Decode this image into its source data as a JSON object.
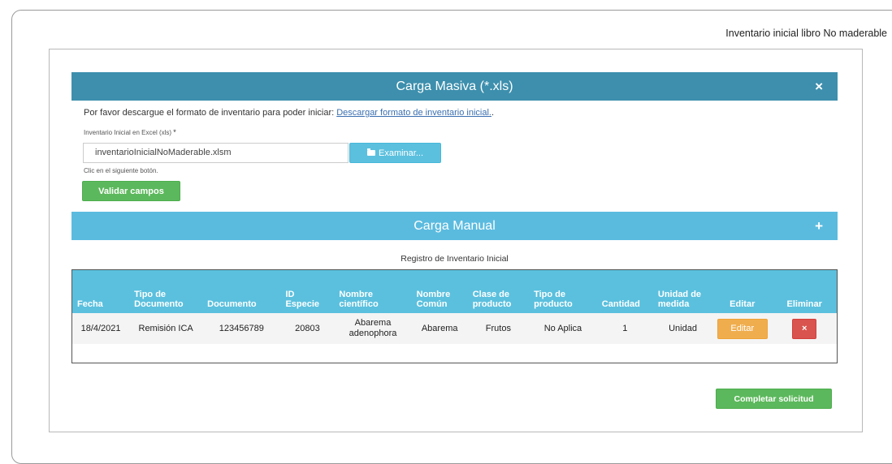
{
  "page": {
    "header_title": "Inventario inicial libro No maderable"
  },
  "carga_masiva": {
    "title": "Carga Masiva (*.xls)",
    "close_icon": "×",
    "intro_text": "Por favor descargue el formato de inventario para poder iniciar: ",
    "download_link": "Descargar formato de inventario inicial.",
    "intro_suffix": ".",
    "file_label": "Inventario Inicial en Excel (xls)",
    "required_mark": "*",
    "file_value": "inventarioInicialNoMaderable.xlsm",
    "browse_label": "Examinar...",
    "browse_icon": "folder-icon",
    "click_hint": "Clic en el siguiente botón.",
    "validate_label": "Validar campos"
  },
  "carga_manual": {
    "title": "Carga Manual",
    "expand_icon": "+"
  },
  "registro": {
    "caption": "Registro de Inventario Inicial",
    "columns": [
      "Fecha",
      "Tipo de Documento",
      "Documento",
      "ID Especie",
      "Nombre científico",
      "Nombre Común",
      "Clase de producto",
      "Tipo de producto",
      "Cantidad",
      "Unidad de medida",
      "Editar",
      "Eliminar"
    ],
    "rows": [
      {
        "fecha": "18/4/2021",
        "tipo_documento": "Remisión ICA",
        "documento": "123456789",
        "id_especie": "20803",
        "nombre_cientifico": "Abarema adenophora",
        "nombre_comun": "Abarema",
        "clase_producto": "Frutos",
        "tipo_producto": "No Aplica",
        "cantidad": "1",
        "unidad_medida": "Unidad",
        "editar_label": "Editar",
        "eliminar_label": "×"
      }
    ]
  },
  "footer": {
    "complete_label": "Completar solicitud"
  },
  "colors": {
    "masiva_bar": "#3d8fad",
    "manual_bar": "#5bbbdf",
    "table_header": "#5bc0de",
    "green": "#5cb85c",
    "orange": "#f0ad4e",
    "red": "#d9534f"
  }
}
